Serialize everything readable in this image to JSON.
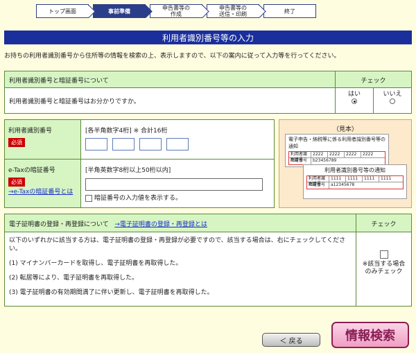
{
  "steps": [
    {
      "label": "トップ画面"
    },
    {
      "label": "事前準備"
    },
    {
      "label": "申告書等の\n作成"
    },
    {
      "label": "申告書等の\n送信・印刷"
    },
    {
      "label": "終了"
    }
  ],
  "page_title": "利用者識別番号等の入力",
  "intro": "お持ちの利用者識別番号から住所等の情報を検索の上、表示しますので、以下の案内に従って入力等を行ってください。",
  "question1": {
    "header": "利用者識別番号と暗証番号について",
    "check_header": "チェック",
    "text": "利用者識別番号と暗証番号はお分かりですか。",
    "yes_label": "はい",
    "no_label": "いいえ",
    "selected": "はい"
  },
  "form": {
    "id_label": "利用者識別番号",
    "required": "必須",
    "id_hint": "[各半角数字4桁] ※ 合計16桁",
    "pw_label": "e-Taxの暗証番号",
    "pw_link": "→e-Taxの暗証番号とは",
    "pw_hint": "[半角英数字8桁以上50桁以内]",
    "show_pw_label": "暗証番号の入力値を表示する。"
  },
  "sample": {
    "title": "（見本）",
    "card1_title": "電子申告・納税等に係る利用者識別番号等の通知",
    "card1_row1_label": "利用者識別番号",
    "card1_row1_values": [
      "2222",
      "2222",
      "2222",
      "2222"
    ],
    "card1_row2_label": "暗証番号",
    "card1_row2_value": "b23456789",
    "card2_title": "利用者識別番号等の通知",
    "card2_row1_label": "利用者識別番号",
    "card2_row1_values": [
      "1111",
      "1111",
      "1111",
      "1111"
    ],
    "card2_row2_label": "暗証番号",
    "card2_row2_value": "a12345678"
  },
  "question2": {
    "header": "電子証明書の登録・再登録について",
    "link": "→電子証明書の登録・再登録とは",
    "check_header": "チェック",
    "text": "以下のいずれかに該当する方は、電子証明書の登録・再登録が必要ですので、該当する場合は、右にチェックしてください。",
    "items": [
      "(1) マイナンバーカードを取得し、電子証明書を再取得した。",
      "(2) 転居等により、電子証明書を再取得した。",
      "(3) 電子証明書の有効期間満了に伴い更新し、電子証明書を再取得した。"
    ],
    "check_note": "※該当する場合\nのみチェック"
  },
  "buttons": {
    "back": "＜ 戻る",
    "search": "情報検索"
  }
}
